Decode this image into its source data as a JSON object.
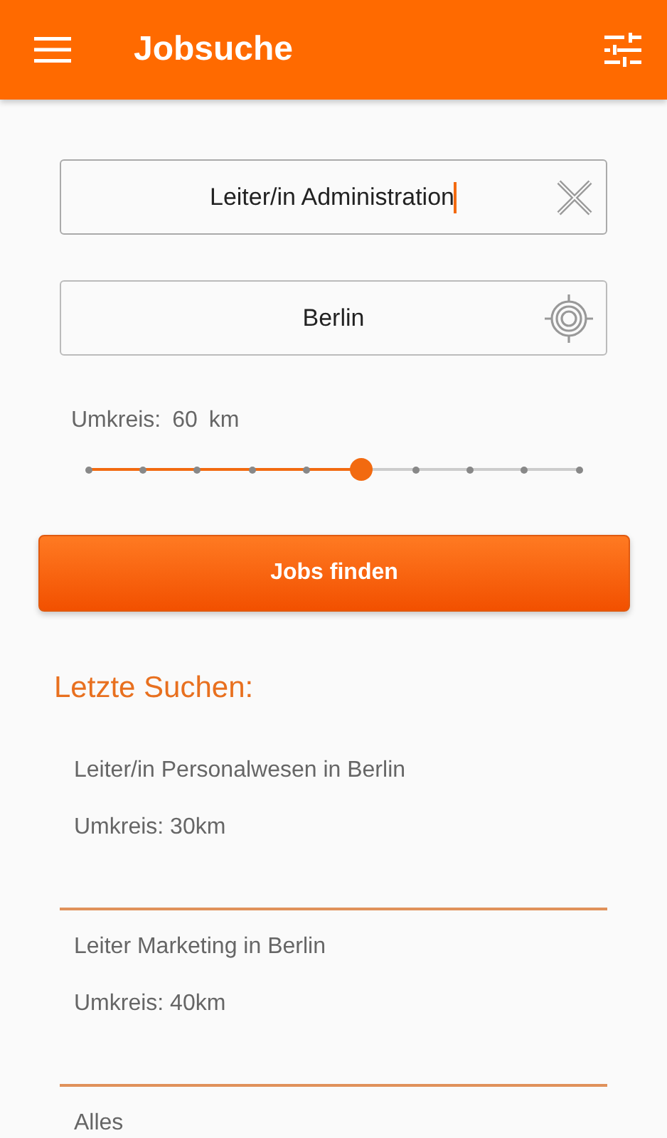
{
  "app_bar": {
    "title": "Jobsuche"
  },
  "job_field": {
    "value": "Leiter/in Administration",
    "focused": true
  },
  "location_field": {
    "value": "Berlin"
  },
  "radius": {
    "label": "Umkreis:",
    "value": "60",
    "unit": "km",
    "level": 0.5556
  },
  "search_button": "Jobs finden",
  "recent": {
    "heading": "Letzte Suchen:",
    "items": [
      {
        "query": "Leiter/in Personalwesen in Berlin",
        "radius": "Umkreis: 30km"
      },
      {
        "query": "Leiter Marketing in Berlin",
        "radius": "Umkreis: 40km"
      },
      {
        "query": "Alles"
      }
    ]
  }
}
